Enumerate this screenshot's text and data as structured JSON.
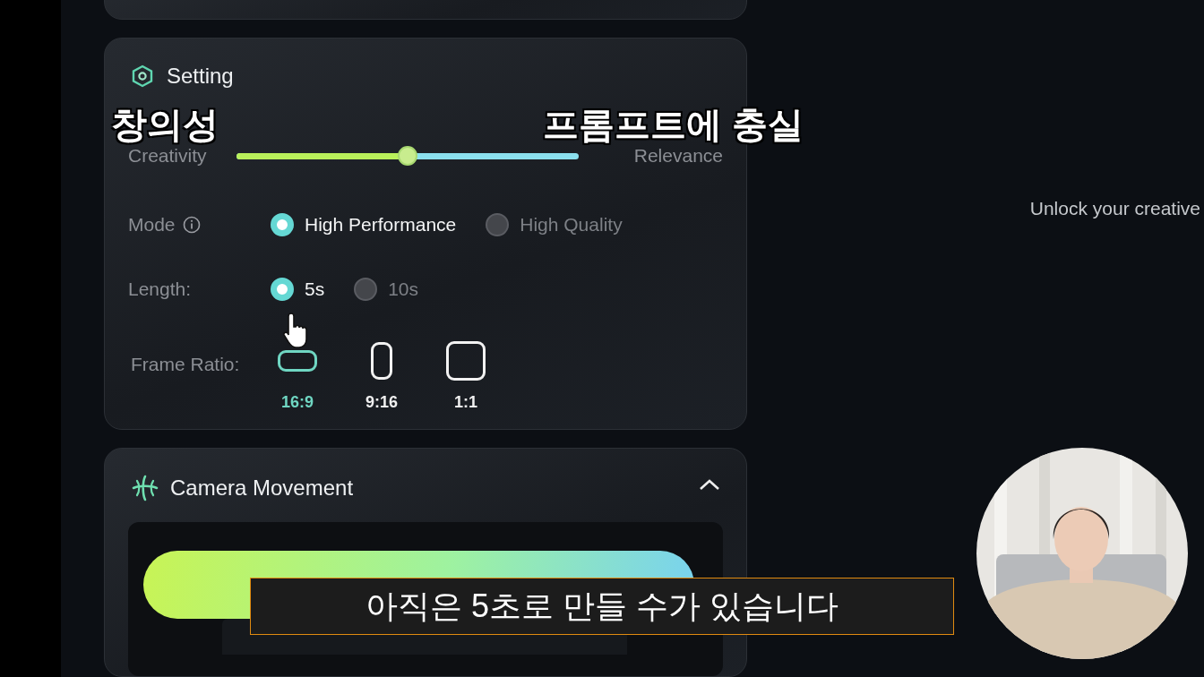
{
  "setting": {
    "title": "Setting",
    "slider": {
      "left_label": "Creativity",
      "right_label": "Relevance",
      "level": 0.5
    },
    "rows": [
      {
        "label": "Mode",
        "info": true,
        "options": [
          {
            "label": "High Performance",
            "selected": true
          },
          {
            "label": "High Quality",
            "selected": false
          }
        ]
      },
      {
        "label": "Length:",
        "info": false,
        "options": [
          {
            "label": "5s",
            "selected": true
          },
          {
            "label": "10s",
            "selected": false
          }
        ]
      }
    ],
    "frame_ratio": {
      "label": "Frame Ratio:",
      "options": [
        {
          "label": "16:9",
          "kind": "landscape",
          "selected": true
        },
        {
          "label": "9:16",
          "kind": "portrait",
          "selected": false
        },
        {
          "label": "1:1",
          "kind": "square",
          "selected": false
        }
      ]
    }
  },
  "camera_movement": {
    "title": "Camera Movement",
    "expanded": true
  },
  "hero_text": "Unlock your creative",
  "captions": [
    {
      "text": "창의성"
    },
    {
      "text": "프롬프트에 충실"
    }
  ],
  "subtitle": "아직은 5초로 만들 수가 있습니다"
}
